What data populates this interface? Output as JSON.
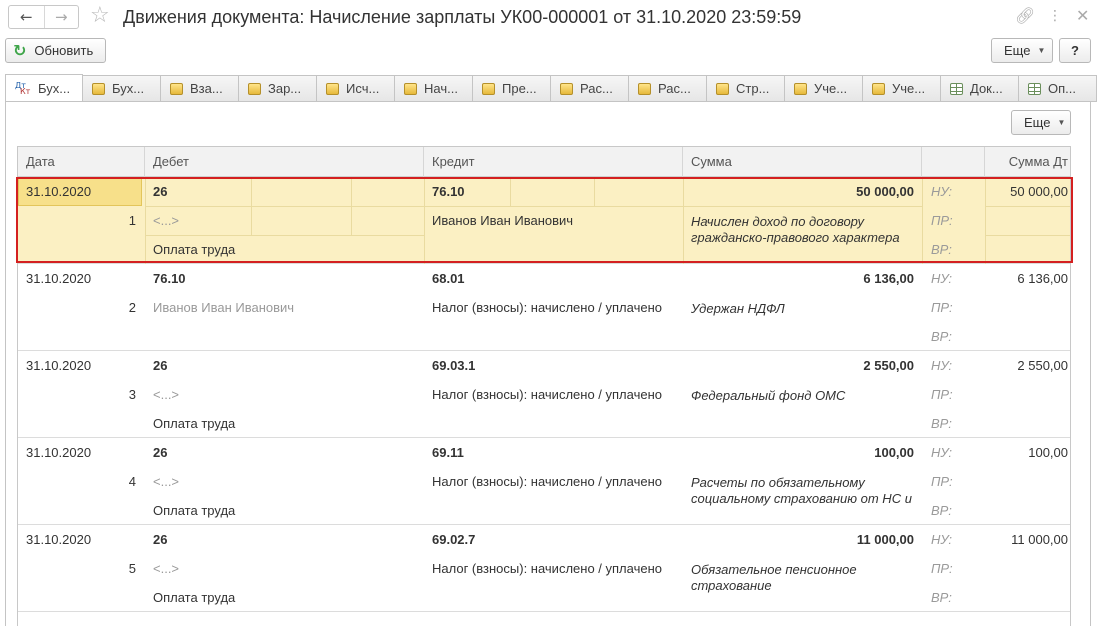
{
  "window": {
    "title": "Движения документа: Начисление зарплаты УК00-000001 от 31.10.2020 23:59:59",
    "back_icon": "arrow-left-icon",
    "forward_icon": "arrow-right-icon",
    "favorite_icon": "star-icon",
    "link_icon": "link-icon",
    "menu_icon": "vertical-dots-icon",
    "close_icon": "close-icon"
  },
  "toolbar": {
    "refresh_label": "Обновить",
    "more_label": "Еще",
    "help_label": "?"
  },
  "tabs": [
    {
      "label": "Бух...",
      "icon": "dt-kt-icon",
      "active": true
    },
    {
      "label": "Бух...",
      "icon": "register-icon"
    },
    {
      "label": "Вза...",
      "icon": "register-icon"
    },
    {
      "label": "Зар...",
      "icon": "register-icon"
    },
    {
      "label": "Исч...",
      "icon": "register-icon"
    },
    {
      "label": "Нач...",
      "icon": "register-icon"
    },
    {
      "label": "Пре...",
      "icon": "register-icon"
    },
    {
      "label": "Рас...",
      "icon": "register-icon"
    },
    {
      "label": "Рас...",
      "icon": "register-icon"
    },
    {
      "label": "Стр...",
      "icon": "register-icon"
    },
    {
      "label": "Уче...",
      "icon": "register-icon"
    },
    {
      "label": "Уче...",
      "icon": "register-icon"
    },
    {
      "label": "Док...",
      "icon": "table-icon"
    },
    {
      "label": "Оп...",
      "icon": "table-icon"
    }
  ],
  "panel": {
    "more_label": "Еще"
  },
  "table": {
    "headers": {
      "date": "Дата",
      "debit": "Дебет",
      "credit": "Кредит",
      "sum": "Сумма",
      "blank": "",
      "sum_dt": "Сумма Дт"
    },
    "rows": [
      {
        "date": "31.10.2020",
        "num": "1",
        "debit_account": "26",
        "debit_sub1": "<...>",
        "debit_sub2": "Оплата труда",
        "credit_account": "76.10",
        "credit_sub1": "Иванов Иван Иванович",
        "credit_sub2": "",
        "sum": "50 000,00",
        "content": "Начислен доход по договору гражданско-правового характера",
        "nu_label": "НУ:",
        "pr_label": "ПР:",
        "vr_label": "ВР:",
        "sum_dt": "50 000,00",
        "selected": true
      },
      {
        "date": "31.10.2020",
        "num": "2",
        "debit_account": "76.10",
        "debit_sub1": "Иванов Иван Иванович",
        "debit_sub2": "",
        "credit_account": "68.01",
        "credit_sub1": "Налог (взносы): начислено / уплачено",
        "credit_sub2": "",
        "sum": "6 136,00",
        "content": "Удержан НДФЛ",
        "nu_label": "НУ:",
        "pr_label": "ПР:",
        "vr_label": "ВР:",
        "sum_dt": "6 136,00"
      },
      {
        "date": "31.10.2020",
        "num": "3",
        "debit_account": "26",
        "debit_sub1": "<...>",
        "debit_sub2": "Оплата труда",
        "credit_account": "69.03.1",
        "credit_sub1": "Налог (взносы): начислено / уплачено",
        "credit_sub2": "",
        "sum": "2 550,00",
        "content": "Федеральный фонд ОМС",
        "nu_label": "НУ:",
        "pr_label": "ПР:",
        "vr_label": "ВР:",
        "sum_dt": "2 550,00"
      },
      {
        "date": "31.10.2020",
        "num": "4",
        "debit_account": "26",
        "debit_sub1": "<...>",
        "debit_sub2": "Оплата труда",
        "credit_account": "69.11",
        "credit_sub1": "Налог (взносы): начислено / уплачено",
        "credit_sub2": "",
        "sum": "100,00",
        "content": "Расчеты по обязательному социальному страхованию от НС и",
        "nu_label": "НУ:",
        "pr_label": "ПР:",
        "vr_label": "ВР:",
        "sum_dt": "100,00"
      },
      {
        "date": "31.10.2020",
        "num": "5",
        "debit_account": "26",
        "debit_sub1": "<...>",
        "debit_sub2": "Оплата труда",
        "credit_account": "69.02.7",
        "credit_sub1": "Налог (взносы): начислено / уплачено",
        "credit_sub2": "",
        "sum": "11 000,00",
        "content": "Обязательное пенсионное страхование",
        "nu_label": "НУ:",
        "pr_label": "ПР:",
        "vr_label": "ВР:",
        "sum_dt": "11 000,00"
      }
    ]
  },
  "colors": {
    "selected_row": "#fbf0c3",
    "highlight_border": "#d42020",
    "refresh_icon": "#3fa54a"
  }
}
